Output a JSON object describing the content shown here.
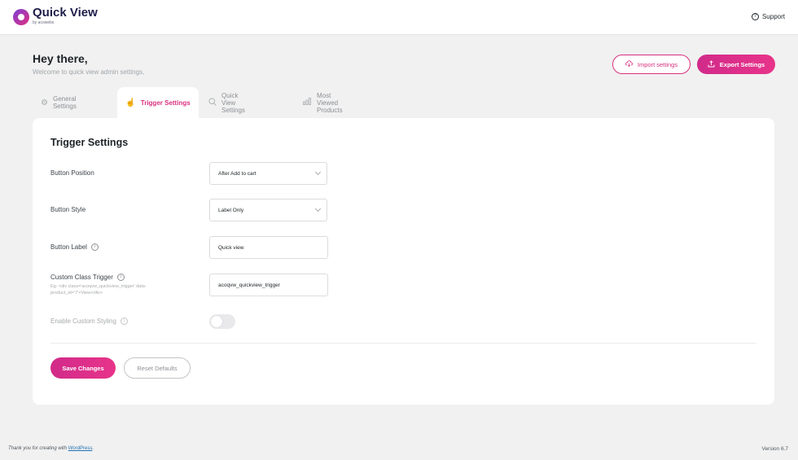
{
  "header": {
    "brand": "Quick View",
    "brand_sub": "by acowebs",
    "support_label": "Support"
  },
  "intro": {
    "greeting": "Hey there,",
    "subtitle": "Welcome to quick view admin settings,"
  },
  "actions": {
    "import_label": "Import settings",
    "export_label": "Export Settings"
  },
  "tabs": [
    {
      "label": "General Settings",
      "icon": "gear-icon",
      "active": false
    },
    {
      "label": "Trigger Settings",
      "icon": "pointer-hand-icon",
      "active": true
    },
    {
      "label": "Quick View Settings",
      "icon": "search-icon",
      "active": false
    },
    {
      "label": "Most Viewed Products",
      "icon": "bar-chart-icon",
      "active": false
    }
  ],
  "panel": {
    "title": "Trigger Settings",
    "button_position": {
      "label": "Button Position",
      "value": "After Add to cart"
    },
    "button_style": {
      "label": "Button Style",
      "value": "Label Only"
    },
    "button_label": {
      "label": "Button Label",
      "value": "Quick view"
    },
    "custom_class": {
      "label": "Custom Class Trigger",
      "hint": "Eg: <div class='acoqvw_quickview_trigger' data-product_id='7'>View</div>",
      "value": "acoqvw_quickview_trigger"
    },
    "custom_styling": {
      "label": "Enable Custom Styling",
      "enabled": false
    },
    "save_label": "Save Changes",
    "reset_label": "Reset Defaults"
  },
  "footer": {
    "thanks_prefix": "Thank you for creating with ",
    "thanks_link": "WordPress",
    "thanks_suffix": ".",
    "version": "Version 6.7"
  },
  "colors": {
    "accent": "#d9307e",
    "background": "#f1f1f1"
  }
}
